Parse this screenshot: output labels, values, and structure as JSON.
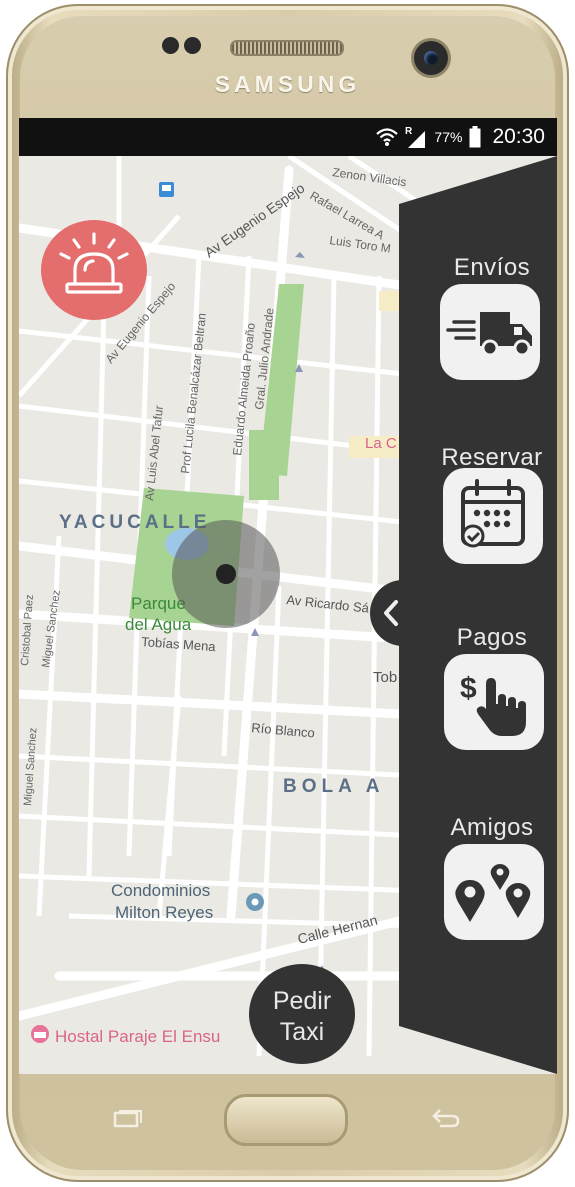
{
  "device": {
    "brand": "SAMSUNG"
  },
  "status_bar": {
    "battery": "77%",
    "time": "20:30",
    "roaming": "R"
  },
  "map": {
    "labels": {
      "av_eugenio_espejo_1": "Av Eugenio Espejo",
      "av_eugenio_espejo_2": "Av Eugenio Espejo",
      "zenon_villacis": "Zenon Villacis",
      "rafael_larrea": "Rafael Larrea A",
      "luis_toro": "Luis Toro M",
      "prof_lucila": "Prof Lucila Benalcázar Beltran",
      "eduardo_almeida": "Eduardo Almeida Proaño",
      "gral_julio": "Gral. Julio Andrade",
      "av_luis_abel": "Av Luis Abel Tafur",
      "yacucalle": "YACUCALLE",
      "parque_1": "Parque",
      "parque_2": "del Agua",
      "av_ricardo": "Av Ricardo Sá",
      "tobias_mena": "Tobías Mena",
      "tob": "Tob",
      "rio_blanco": "Río Blanco",
      "bola": "BOLA A",
      "cond_1": "Condominios",
      "cond_2": "Milton Reyes",
      "calle_hernan": "Calle Hernan",
      "hostal": "Hostal Paraje El Ensu",
      "miguel_sanchez_1": "Miguel Sanchez",
      "miguel_sanchez_2": "Miguel Sanchez",
      "cristobal_paez": "Cristobal Paez",
      "la_c": "La C"
    }
  },
  "menu": {
    "items": [
      {
        "label": "Envíos",
        "icon": "truck-icon"
      },
      {
        "label": "Reservar",
        "icon": "calendar-icon"
      },
      {
        "label": "Pagos",
        "icon": "payment-hand-icon"
      },
      {
        "label": "Amigos",
        "icon": "friends-location-icon"
      }
    ]
  },
  "order_button": {
    "line1": "Pedir",
    "line2": "Taxi"
  },
  "colors": {
    "alarm": "#e46d6d",
    "panel": "#333333",
    "park": "#a8d493",
    "map_bg": "#ebe9e4"
  }
}
